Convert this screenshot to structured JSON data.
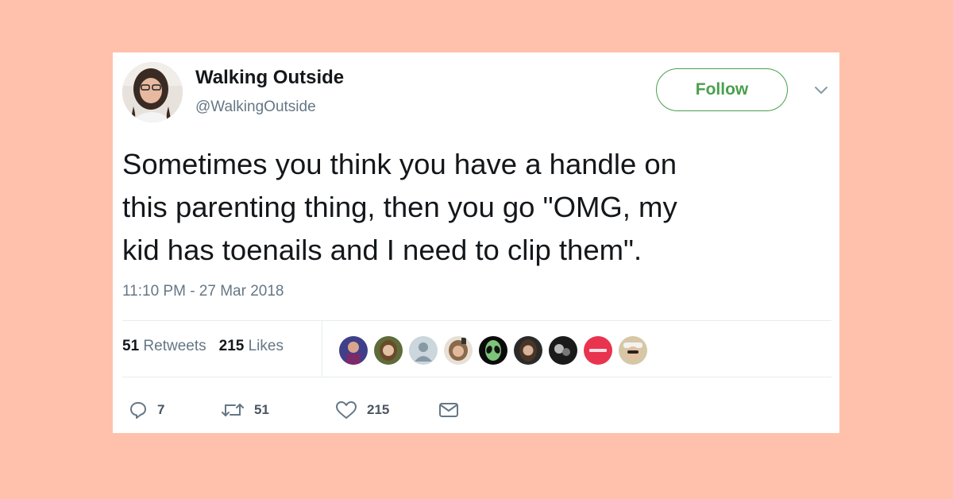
{
  "colors": {
    "background": "#ffc1ac",
    "card": "#ffffff",
    "follow_accent": "#4a9f4e",
    "text_primary": "#14171a",
    "text_secondary": "#657786"
  },
  "user": {
    "display_name": "Walking Outside",
    "handle": "@WalkingOutside",
    "avatar_icon": "user-avatar-photo"
  },
  "header": {
    "follow_label": "Follow",
    "more_icon": "chevron-down-icon"
  },
  "tweet": {
    "text": "Sometimes you think you have a handle on\nthis parenting thing, then you go \"OMG, my\nkid has toenails and I need to clip them\".",
    "timestamp": "11:10 PM - 27 Mar 2018"
  },
  "stats": {
    "retweets_count": "51",
    "retweets_label": "Retweets",
    "likes_count": "215",
    "likes_label": "Likes"
  },
  "likers": [
    {
      "name": "liker-avatar-1",
      "icon": "person-photo"
    },
    {
      "name": "liker-avatar-2",
      "icon": "person-photo"
    },
    {
      "name": "liker-avatar-3",
      "icon": "default-egg-avatar"
    },
    {
      "name": "liker-avatar-4",
      "icon": "person-photo"
    },
    {
      "name": "liker-avatar-5",
      "icon": "alien-icon"
    },
    {
      "name": "liker-avatar-6",
      "icon": "person-photo"
    },
    {
      "name": "liker-avatar-7",
      "icon": "person-photo"
    },
    {
      "name": "liker-avatar-8",
      "icon": "red-logo"
    },
    {
      "name": "liker-avatar-9",
      "icon": "person-photo"
    }
  ],
  "actions": {
    "reply_count": "7",
    "retweet_count": "51",
    "like_count": "215",
    "reply_icon": "reply-icon",
    "retweet_icon": "retweet-icon",
    "like_icon": "heart-icon",
    "dm_icon": "envelope-icon"
  }
}
